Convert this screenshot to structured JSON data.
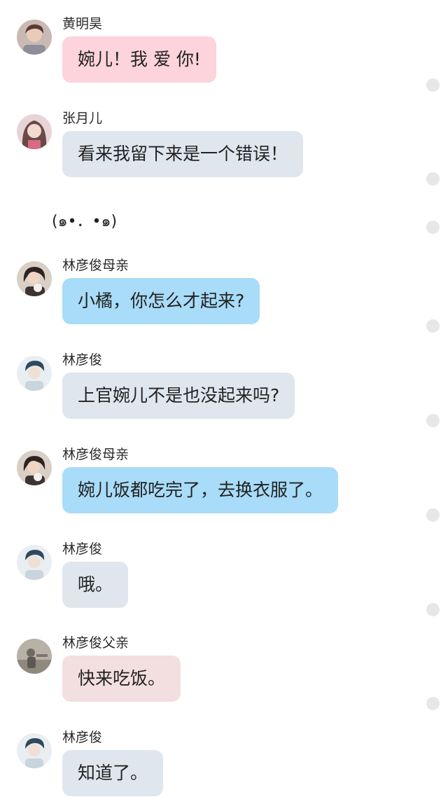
{
  "colors": {
    "pink_bubble": "#fdd3dc",
    "grey_bubble": "#dfe6ed",
    "blue_bubble": "#a8dcf8",
    "rose_bubble": "#f3dfe0",
    "selection_dot": "#e7e7e7"
  },
  "messages": [
    {
      "sender": "黄明昊",
      "text": "婉儿！我 爱 你!",
      "bubble_color": "pink"
    },
    {
      "sender": "张月儿",
      "text": "看来我留下来是一个错误！",
      "bubble_color": "grey"
    },
    {
      "sender": "林彦俊母亲",
      "text": "小橘，你怎么才起来?",
      "bubble_color": "blue"
    },
    {
      "sender": "林彦俊",
      "text": "上官婉儿不是也没起来吗?",
      "bubble_color": "grey"
    },
    {
      "sender": "林彦俊母亲",
      "text": "婉儿饭都吃完了，去换衣服了。",
      "bubble_color": "blue"
    },
    {
      "sender": "林彦俊",
      "text": "哦。",
      "bubble_color": "grey"
    },
    {
      "sender": "林彦俊父亲",
      "text": "快来吃饭。",
      "bubble_color": "rose"
    },
    {
      "sender": "林彦俊",
      "text": "知道了。",
      "bubble_color": "grey"
    }
  ],
  "aside": {
    "text": "(๑•．•๑)"
  },
  "icons": {
    "avatar": "avatar-icon",
    "select_dot": "select-dot-icon"
  }
}
